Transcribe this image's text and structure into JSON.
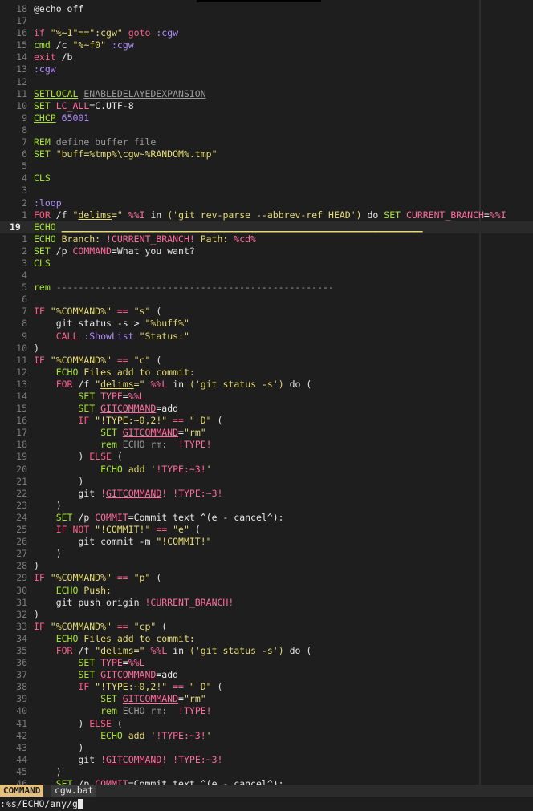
{
  "editor": {
    "lines": [
      {
        "num": "18",
        "code": [
          [
            "c-plain",
            "@echo off"
          ]
        ]
      },
      {
        "num": "17",
        "code": []
      },
      {
        "num": "16",
        "code": [
          [
            "c-kw",
            "if "
          ],
          [
            "c-str",
            "\"%~1\"==\":cgw\""
          ],
          [
            "c-kw",
            " goto "
          ],
          [
            "c-lbl",
            ":cgw"
          ]
        ]
      },
      {
        "num": "15",
        "code": [
          [
            "c-cmd",
            "cmd "
          ],
          [
            "c-plain",
            "/c "
          ],
          [
            "c-str",
            "\"%~f0\""
          ],
          [
            "c-plain",
            " "
          ],
          [
            "c-lbl",
            ":cgw"
          ]
        ]
      },
      {
        "num": "14",
        "code": [
          [
            "c-kw",
            "exit "
          ],
          [
            "c-plain",
            "/b"
          ]
        ]
      },
      {
        "num": "13",
        "code": [
          [
            "c-lbl",
            ":cgw"
          ]
        ]
      },
      {
        "num": "12",
        "code": []
      },
      {
        "num": "11",
        "code": [
          [
            "c-cmd u",
            "SETLOCAL"
          ],
          [
            "c-plain",
            " "
          ],
          [
            "c-cm u",
            "ENABLEDELAYEDEXPANSION"
          ]
        ]
      },
      {
        "num": "10",
        "code": [
          [
            "c-cmd",
            "SET "
          ],
          [
            "c-var",
            "LC_ALL"
          ],
          [
            "c-plain",
            "=C.UTF-8"
          ]
        ]
      },
      {
        "num": "9",
        "code": [
          [
            "c-cmd u",
            "CHCP"
          ],
          [
            "c-plain",
            " "
          ],
          [
            "c-num",
            "65001"
          ]
        ]
      },
      {
        "num": "8",
        "code": []
      },
      {
        "num": "7",
        "code": [
          [
            "c-rem",
            "REM "
          ],
          [
            "c-cm",
            "define buffer file"
          ]
        ]
      },
      {
        "num": "6",
        "code": [
          [
            "c-cmd",
            "SET "
          ],
          [
            "c-str",
            "\"buff=%tmp%\\cgw~%RANDOM%.tmp\""
          ]
        ]
      },
      {
        "num": "5",
        "code": []
      },
      {
        "num": "4",
        "code": [
          [
            "c-cmd",
            "CLS"
          ]
        ]
      },
      {
        "num": "3",
        "code": []
      },
      {
        "num": "2",
        "code": [
          [
            "c-lbl",
            ":loop"
          ]
        ]
      },
      {
        "num": "1",
        "code": [
          [
            "c-kw",
            "FOR "
          ],
          [
            "c-plain",
            "/f "
          ],
          [
            "c-str",
            "\""
          ],
          [
            "c-str u",
            "delims"
          ],
          [
            "c-str",
            "=\""
          ],
          [
            "c-plain",
            " "
          ],
          [
            "c-var",
            "%%I"
          ],
          [
            "c-plain",
            " in "
          ],
          [
            "c-str",
            "('git rev-parse --abbrev-ref HEAD')"
          ],
          [
            "c-plain",
            " do "
          ],
          [
            "c-cmd",
            "SET "
          ],
          [
            "c-var",
            "CURRENT_BRANCH"
          ],
          [
            "c-plain",
            "="
          ],
          [
            "c-var",
            "%%I"
          ]
        ]
      },
      {
        "num": "19",
        "cur": true,
        "code": [
          [
            "c-echo",
            "ECHO "
          ],
          [
            "c-echotext u",
            "_________________________________________________________________"
          ]
        ]
      },
      {
        "num": "1",
        "code": [
          [
            "c-echo",
            "ECHO "
          ],
          [
            "c-echotext",
            "Branch: "
          ],
          [
            "c-var",
            "!CURRENT_BRANCH!"
          ],
          [
            "c-echotext",
            " Path: "
          ],
          [
            "c-var",
            "%cd%"
          ]
        ]
      },
      {
        "num": "2",
        "code": [
          [
            "c-cmd",
            "SET "
          ],
          [
            "c-plain",
            "/p "
          ],
          [
            "c-var",
            "COMMAND"
          ],
          [
            "c-plain",
            "=What you want?"
          ]
        ]
      },
      {
        "num": "3",
        "code": [
          [
            "c-cmd",
            "CLS"
          ]
        ]
      },
      {
        "num": "4",
        "code": []
      },
      {
        "num": "5",
        "code": [
          [
            "c-rem",
            "rem "
          ],
          [
            "c-cm",
            "--------------------------------------------------"
          ]
        ]
      },
      {
        "num": "6",
        "code": []
      },
      {
        "num": "7",
        "code": [
          [
            "c-kw",
            "IF "
          ],
          [
            "c-str",
            "\"%COMMAND%\""
          ],
          [
            "c-op",
            " == "
          ],
          [
            "c-str",
            "\"s\""
          ],
          [
            "c-plain",
            " ("
          ]
        ]
      },
      {
        "num": "8",
        "code": [
          [
            "c-plain",
            "    git status -s > "
          ],
          [
            "c-str",
            "\"%buff%\""
          ]
        ]
      },
      {
        "num": "9",
        "code": [
          [
            "c-plain",
            "    "
          ],
          [
            "c-kw",
            "CALL "
          ],
          [
            "c-lbl",
            ":ShowList"
          ],
          [
            "c-plain",
            " "
          ],
          [
            "c-str",
            "\"Status:\""
          ]
        ]
      },
      {
        "num": "10",
        "code": [
          [
            "c-plain",
            ")"
          ]
        ]
      },
      {
        "num": "11",
        "code": [
          [
            "c-kw",
            "IF "
          ],
          [
            "c-str",
            "\"%COMMAND%\""
          ],
          [
            "c-op",
            " == "
          ],
          [
            "c-str",
            "\"c\""
          ],
          [
            "c-plain",
            " ("
          ]
        ]
      },
      {
        "num": "12",
        "code": [
          [
            "c-plain",
            "    "
          ],
          [
            "c-echo",
            "ECHO "
          ],
          [
            "c-echotext",
            "Files add to commit:"
          ]
        ]
      },
      {
        "num": "13",
        "code": [
          [
            "c-plain",
            "    "
          ],
          [
            "c-kw",
            "FOR "
          ],
          [
            "c-plain",
            "/f "
          ],
          [
            "c-str",
            "\""
          ],
          [
            "c-str u",
            "delims"
          ],
          [
            "c-str",
            "=\""
          ],
          [
            "c-plain",
            " "
          ],
          [
            "c-var",
            "%%L"
          ],
          [
            "c-plain",
            " in "
          ],
          [
            "c-str",
            "('git status -s')"
          ],
          [
            "c-plain",
            " do ("
          ]
        ]
      },
      {
        "num": "14",
        "code": [
          [
            "c-plain",
            "        "
          ],
          [
            "c-cmd",
            "SET "
          ],
          [
            "c-var",
            "TYPE"
          ],
          [
            "c-plain",
            "="
          ],
          [
            "c-var",
            "%%L"
          ]
        ]
      },
      {
        "num": "15",
        "code": [
          [
            "c-plain",
            "        "
          ],
          [
            "c-cmd",
            "SET "
          ],
          [
            "c-var u",
            "GITCOMMAND"
          ],
          [
            "c-plain",
            "=add"
          ]
        ]
      },
      {
        "num": "16",
        "code": [
          [
            "c-plain",
            "        "
          ],
          [
            "c-kw",
            "IF "
          ],
          [
            "c-str",
            "\"!TYPE:~0,2!\""
          ],
          [
            "c-op",
            " == "
          ],
          [
            "c-str",
            "\" D\""
          ],
          [
            "c-plain",
            " ("
          ]
        ]
      },
      {
        "num": "17",
        "code": [
          [
            "c-plain",
            "            "
          ],
          [
            "c-cmd",
            "SET "
          ],
          [
            "c-var u",
            "GITCOMMAND"
          ],
          [
            "c-plain",
            "="
          ],
          [
            "c-str",
            "\"rm\""
          ]
        ]
      },
      {
        "num": "18",
        "code": [
          [
            "c-plain",
            "            "
          ],
          [
            "c-rem",
            "rem "
          ],
          [
            "c-cm",
            "ECHO rm:  "
          ],
          [
            "c-var",
            "!TYPE!"
          ]
        ]
      },
      {
        "num": "19",
        "code": [
          [
            "c-plain",
            "        ) "
          ],
          [
            "c-kw",
            "ELSE"
          ],
          [
            "c-plain",
            " ("
          ]
        ]
      },
      {
        "num": "20",
        "code": [
          [
            "c-plain",
            "            "
          ],
          [
            "c-echo",
            "ECHO "
          ],
          [
            "c-echotext",
            "add '"
          ],
          [
            "c-var",
            "!TYPE:~3!"
          ],
          [
            "c-echotext",
            "'"
          ]
        ]
      },
      {
        "num": "21",
        "code": [
          [
            "c-plain",
            "        )"
          ]
        ]
      },
      {
        "num": "22",
        "code": [
          [
            "c-plain",
            "        git "
          ],
          [
            "c-var",
            "!"
          ],
          [
            "c-var u",
            "GITCOMMAND"
          ],
          [
            "c-var",
            "!"
          ],
          [
            "c-plain",
            " "
          ],
          [
            "c-var",
            "!TYPE:~3!"
          ]
        ]
      },
      {
        "num": "23",
        "code": [
          [
            "c-plain",
            "    )"
          ]
        ]
      },
      {
        "num": "24",
        "code": [
          [
            "c-plain",
            "    "
          ],
          [
            "c-cmd",
            "SET "
          ],
          [
            "c-plain",
            "/p "
          ],
          [
            "c-var",
            "COMMIT"
          ],
          [
            "c-plain",
            "=Commit text ^(e - cancel^):"
          ]
        ]
      },
      {
        "num": "25",
        "code": [
          [
            "c-plain",
            "    "
          ],
          [
            "c-kw",
            "IF NOT "
          ],
          [
            "c-str",
            "\"!COMMIT!\""
          ],
          [
            "c-op",
            " == "
          ],
          [
            "c-str",
            "\"e\""
          ],
          [
            "c-plain",
            " ("
          ]
        ]
      },
      {
        "num": "26",
        "code": [
          [
            "c-plain",
            "        git commit -m "
          ],
          [
            "c-str",
            "\"!COMMIT!\""
          ]
        ]
      },
      {
        "num": "27",
        "code": [
          [
            "c-plain",
            "    )"
          ]
        ]
      },
      {
        "num": "28",
        "code": [
          [
            "c-plain",
            ")"
          ]
        ]
      },
      {
        "num": "29",
        "code": [
          [
            "c-kw",
            "IF "
          ],
          [
            "c-str",
            "\"%COMMAND%\""
          ],
          [
            "c-op",
            " == "
          ],
          [
            "c-str",
            "\"p\""
          ],
          [
            "c-plain",
            " ("
          ]
        ]
      },
      {
        "num": "30",
        "code": [
          [
            "c-plain",
            "    "
          ],
          [
            "c-echo",
            "ECHO "
          ],
          [
            "c-echotext",
            "Push:"
          ]
        ]
      },
      {
        "num": "31",
        "code": [
          [
            "c-plain",
            "    git push origin "
          ],
          [
            "c-var",
            "!CURRENT_BRANCH!"
          ]
        ]
      },
      {
        "num": "32",
        "code": [
          [
            "c-plain",
            ")"
          ]
        ]
      },
      {
        "num": "33",
        "code": [
          [
            "c-kw",
            "IF "
          ],
          [
            "c-str",
            "\"%COMMAND%\""
          ],
          [
            "c-op",
            " == "
          ],
          [
            "c-str",
            "\"cp\""
          ],
          [
            "c-plain",
            " ("
          ]
        ]
      },
      {
        "num": "34",
        "code": [
          [
            "c-plain",
            "    "
          ],
          [
            "c-echo",
            "ECHO "
          ],
          [
            "c-echotext",
            "Files add to commit:"
          ]
        ]
      },
      {
        "num": "35",
        "code": [
          [
            "c-plain",
            "    "
          ],
          [
            "c-kw",
            "FOR "
          ],
          [
            "c-plain",
            "/f "
          ],
          [
            "c-str",
            "\""
          ],
          [
            "c-str u",
            "delims"
          ],
          [
            "c-str",
            "=\""
          ],
          [
            "c-plain",
            " "
          ],
          [
            "c-var",
            "%%L"
          ],
          [
            "c-plain",
            " in "
          ],
          [
            "c-str",
            "('git status -s')"
          ],
          [
            "c-plain",
            " do ("
          ]
        ]
      },
      {
        "num": "36",
        "code": [
          [
            "c-plain",
            "        "
          ],
          [
            "c-cmd",
            "SET "
          ],
          [
            "c-var",
            "TYPE"
          ],
          [
            "c-plain",
            "="
          ],
          [
            "c-var",
            "%%L"
          ]
        ]
      },
      {
        "num": "37",
        "code": [
          [
            "c-plain",
            "        "
          ],
          [
            "c-cmd",
            "SET "
          ],
          [
            "c-var u",
            "GITCOMMAND"
          ],
          [
            "c-plain",
            "=add"
          ]
        ]
      },
      {
        "num": "38",
        "code": [
          [
            "c-plain",
            "        "
          ],
          [
            "c-kw",
            "IF "
          ],
          [
            "c-str",
            "\"!TYPE:~0,2!\""
          ],
          [
            "c-op",
            " == "
          ],
          [
            "c-str",
            "\" D\""
          ],
          [
            "c-plain",
            " ("
          ]
        ]
      },
      {
        "num": "39",
        "code": [
          [
            "c-plain",
            "            "
          ],
          [
            "c-cmd",
            "SET "
          ],
          [
            "c-var u",
            "GITCOMMAND"
          ],
          [
            "c-plain",
            "="
          ],
          [
            "c-str",
            "\"rm\""
          ]
        ]
      },
      {
        "num": "40",
        "code": [
          [
            "c-plain",
            "            "
          ],
          [
            "c-rem",
            "rem "
          ],
          [
            "c-cm",
            "ECHO rm:  "
          ],
          [
            "c-var",
            "!TYPE!"
          ]
        ]
      },
      {
        "num": "41",
        "code": [
          [
            "c-plain",
            "        ) "
          ],
          [
            "c-kw",
            "ELSE"
          ],
          [
            "c-plain",
            " ("
          ]
        ]
      },
      {
        "num": "42",
        "code": [
          [
            "c-plain",
            "            "
          ],
          [
            "c-echo",
            "ECHO "
          ],
          [
            "c-echotext",
            "add '"
          ],
          [
            "c-var",
            "!TYPE:~3!"
          ],
          [
            "c-echotext",
            "'"
          ]
        ]
      },
      {
        "num": "43",
        "code": [
          [
            "c-plain",
            "        )"
          ]
        ]
      },
      {
        "num": "44",
        "code": [
          [
            "c-plain",
            "        git "
          ],
          [
            "c-var",
            "!"
          ],
          [
            "c-var u",
            "GITCOMMAND"
          ],
          [
            "c-var",
            "!"
          ],
          [
            "c-plain",
            " "
          ],
          [
            "c-var",
            "!TYPE:~3!"
          ]
        ]
      },
      {
        "num": "45",
        "code": [
          [
            "c-plain",
            "    )"
          ]
        ]
      },
      {
        "num": "46",
        "code": [
          [
            "c-plain",
            "    "
          ],
          [
            "c-cmd",
            "SET "
          ],
          [
            "c-plain",
            "/p "
          ],
          [
            "c-var",
            "COMMIT"
          ],
          [
            "c-plain",
            "=Commit text ^(e - cancel^):"
          ]
        ]
      }
    ]
  },
  "statusline": {
    "mode": "COMMAND",
    "filename": "cgw.bat"
  },
  "cmdline": {
    "text": ":%s/ECHO/any/g"
  },
  "colors": {
    "background": "#1e1e1e",
    "mode_badge": "#e5c07b",
    "keyword": "#ff5c8a",
    "string": "#e6db74",
    "command": "#a6e22e",
    "label": "#b18cff"
  },
  "icons": {
    "cursor": "block-cursor-icon"
  }
}
